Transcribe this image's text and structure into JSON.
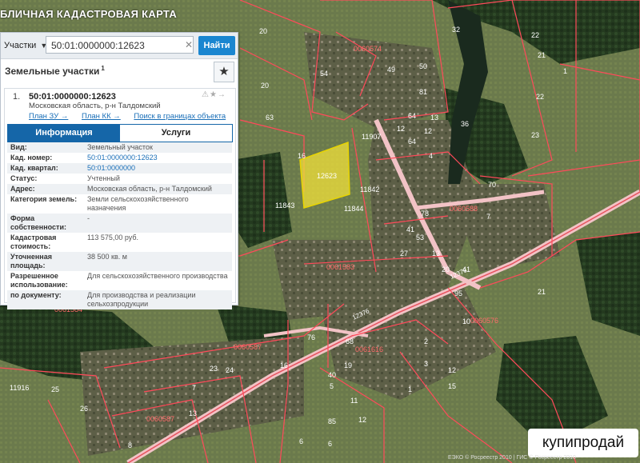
{
  "app": {
    "title": "БЛИЧНАЯ КАДАСТРОВАЯ КАРТА"
  },
  "search": {
    "type_label": "Участки",
    "value": "50:01:0000000:12623",
    "button": "Найти"
  },
  "section": {
    "title": "Земельные участки",
    "count": "1"
  },
  "result": {
    "index": "1.",
    "cadastral": "50:01:0000000:12623",
    "address": "Московская область, р-н Талдомский",
    "links": [
      "План ЗУ →",
      "План КК →",
      "Поиск в границах объекта →"
    ]
  },
  "tabs": [
    "Информация",
    "Услуги"
  ],
  "attributes": [
    {
      "k": "Вид:",
      "v": "Земельный участок"
    },
    {
      "k": "Кад. номер:",
      "v": "50:01:0000000:12623",
      "link": true
    },
    {
      "k": "Кад. квартал:",
      "v": "50:01:0000000",
      "link": true
    },
    {
      "k": "Статус:",
      "v": "Учтенный"
    },
    {
      "k": "Адрес:",
      "v": "Московская область, р-н Талдомский"
    },
    {
      "k": "Категория земель:",
      "v": "Земли сельскохозяйственного назначения"
    },
    {
      "k": "Форма собственности:",
      "v": "-"
    },
    {
      "k": "Кадастровая стоимость:",
      "v": "113 575,00 руб."
    },
    {
      "k": "Уточненная площадь:",
      "v": "38 500 кв. м"
    },
    {
      "k": "Разрешенное использование:",
      "v": "Для сельскохозяйственного производства"
    },
    {
      "k": "по документу:",
      "v": "Для производства и реализации сельхозпродукции"
    }
  ],
  "map": {
    "highlight_label": "12623",
    "quarter_labels": [
      "0060574",
      "0060588",
      "0061583",
      "0060587",
      "0061616",
      "0060576",
      "0061584",
      "0060587"
    ],
    "road_labels": [
      "12376",
      "12376"
    ],
    "parcel_labels": [
      "32",
      "22",
      "21",
      "1",
      "22",
      "23",
      "21",
      "54",
      "50",
      "49",
      "81",
      "20",
      "16",
      "63",
      "20",
      "36",
      "13",
      "12",
      "64",
      "64",
      "4",
      "7",
      "70",
      "11907",
      "11842",
      "11843",
      "11844",
      "12",
      "78",
      "41",
      "53",
      "27",
      "13",
      "20",
      "41",
      "95",
      "76",
      "68",
      "16",
      "19",
      "10",
      "2",
      "3",
      "12",
      "15",
      "1",
      "40",
      "5",
      "11",
      "12",
      "85",
      "11916",
      "25",
      "26",
      "23",
      "24",
      "7",
      "13",
      "6",
      "6",
      "8"
    ]
  },
  "watermark": "купипродай",
  "attribution": "ЕЭКО © Росреестр 2010 | ГИС © Росреестр 2010"
}
